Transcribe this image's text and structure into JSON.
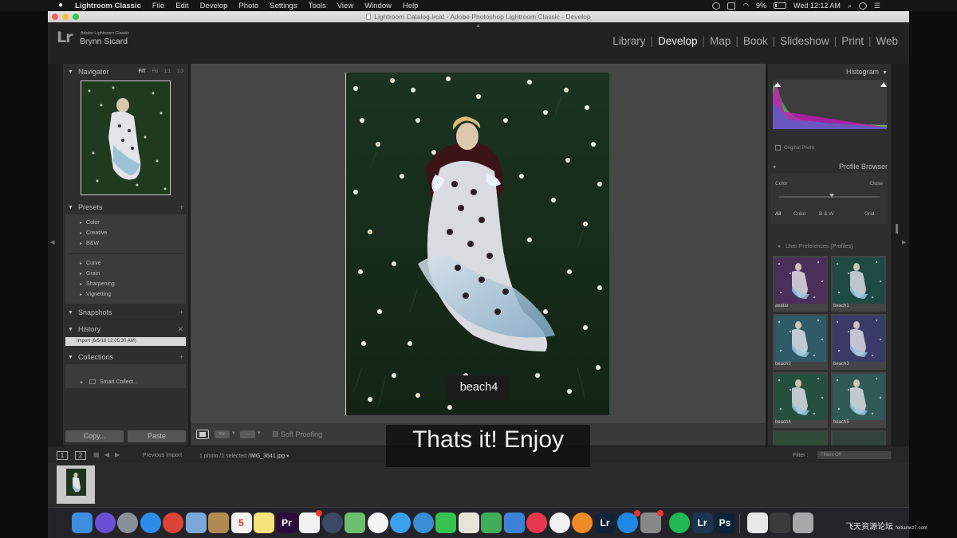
{
  "menubar": {
    "app_name": "Lightroom Classic",
    "items": [
      "File",
      "Edit",
      "Develop",
      "Photo",
      "Settings",
      "Tools",
      "View",
      "Window",
      "Help"
    ],
    "battery": "9%",
    "clock": "Wed 12:12 AM"
  },
  "window": {
    "title": "Lightroom Catalog.lrcat - Adobe Photoshop Lightroom Classic - Develop"
  },
  "identity": {
    "logo": "Lr",
    "app_label": "Adobe Lightroom Classic",
    "user": "Brynn Sicard"
  },
  "modules": [
    {
      "label": "Library",
      "active": false
    },
    {
      "label": "Develop",
      "active": true
    },
    {
      "label": "Map",
      "active": false
    },
    {
      "label": "Book",
      "active": false
    },
    {
      "label": "Slideshow",
      "active": false
    },
    {
      "label": "Print",
      "active": false
    },
    {
      "label": "Web",
      "active": false
    }
  ],
  "left": {
    "navigator": {
      "title": "Navigator",
      "zoom_fit": "FIT",
      "zoom_rest": "Fill  1:1  1:3"
    },
    "presets": {
      "title": "Presets",
      "group1": [
        "Color",
        "Creative",
        "B&W"
      ],
      "group2": [
        "Curve",
        "Grain",
        "Sharpening",
        "Vignetting"
      ]
    },
    "snapshots": {
      "title": "Snapshots"
    },
    "history": {
      "title": "History",
      "item": "Import (6/5/18 12:05:30 AM)"
    },
    "collections": {
      "title": "Collections",
      "item": "Smart Collect..."
    },
    "copy_label": "Copy...",
    "paste_label": "Paste"
  },
  "center": {
    "photo_label": "beach4",
    "soft_proofing": "Soft Proofing"
  },
  "caption": "Thats it! Enjoy",
  "right": {
    "histogram": {
      "title": "Histogram",
      "original_photo": "Original Photo"
    },
    "profile_browser": {
      "title": "Profile Browser",
      "color_label": "Color",
      "close_label": "Close",
      "filters": [
        "All",
        "Color",
        "B & W",
        "Grid"
      ]
    },
    "user_presets": {
      "title": "User Preferences (Profiles)",
      "tiles": [
        {
          "label": "avatar",
          "tint": "#4a2f5a"
        },
        {
          "label": "beach1",
          "tint": "#1f4a44"
        },
        {
          "label": "beach2",
          "tint": "#2f5a68"
        },
        {
          "label": "beach3",
          "tint": "#3a3a68"
        },
        {
          "label": "beach4",
          "tint": "#255040"
        },
        {
          "label": "beach5",
          "tint": "#2f5a55"
        }
      ]
    }
  },
  "filmstrip": {
    "view1": "1",
    "view2": "2",
    "source": "Previous Import",
    "info": "1 photo /1 selected /",
    "filename": "IMG_3641.jpg",
    "filter_label": "Filter :",
    "filter_value": "Filters Off"
  },
  "dock": {
    "apps": [
      {
        "name": "finder-icon",
        "color": "#3d8de0",
        "text": ""
      },
      {
        "name": "siri-icon",
        "color": "#6b4fd6",
        "text": "",
        "round": true
      },
      {
        "name": "launchpad-icon",
        "color": "#8a8f99",
        "text": "",
        "round": true
      },
      {
        "name": "safari-icon",
        "color": "#2e8be8",
        "text": "",
        "round": true
      },
      {
        "name": "chrome-icon",
        "color": "#db4437",
        "text": "",
        "round": true
      },
      {
        "name": "preview-icon",
        "color": "#7aa6d8",
        "text": ""
      },
      {
        "name": "notefile-icon",
        "color": "#b08a50",
        "text": ""
      },
      {
        "name": "calendar-icon",
        "color": "#f2f2f2",
        "text": "5"
      },
      {
        "name": "notes-icon",
        "color": "#f5e27a",
        "text": ""
      },
      {
        "name": "premiere-icon",
        "color": "#2a0b3e",
        "text": "Pr"
      },
      {
        "name": "reminders-icon",
        "color": "#f2f2f2",
        "text": "",
        "badge": true
      },
      {
        "name": "davinci-icon",
        "color": "#3a4a66",
        "text": "",
        "round": true
      },
      {
        "name": "maps-icon",
        "color": "#6cbf6c",
        "text": ""
      },
      {
        "name": "photos-icon",
        "color": "#f3f3f3",
        "text": "",
        "round": true
      },
      {
        "name": "messages-icon",
        "color": "#3aa0f0",
        "text": "",
        "round": true
      },
      {
        "name": "network-icon",
        "color": "#3a8ed8",
        "text": "",
        "round": true
      },
      {
        "name": "facetime-icon",
        "color": "#35c24f",
        "text": ""
      },
      {
        "name": "textedit-icon",
        "color": "#e8e4d8",
        "text": ""
      },
      {
        "name": "numbers-icon",
        "color": "#3fae5a",
        "text": ""
      },
      {
        "name": "keynote-icon",
        "color": "#3b82d8",
        "text": ""
      },
      {
        "name": "news-icon",
        "color": "#e8394e",
        "text": "",
        "round": true
      },
      {
        "name": "itunes-icon",
        "color": "#f0f0f0",
        "text": "",
        "round": true
      },
      {
        "name": "books-icon",
        "color": "#f08a24",
        "text": "",
        "round": true
      },
      {
        "name": "lightroom-icon",
        "color": "#10233a",
        "text": "Lr"
      },
      {
        "name": "appstore-icon",
        "color": "#1e88e5",
        "text": "",
        "round": true,
        "badge": true
      },
      {
        "name": "systemprefs-icon",
        "color": "#888888",
        "text": "",
        "badge": true
      },
      {
        "name": "spotify-icon",
        "color": "#1db954",
        "text": "",
        "round": true
      },
      {
        "name": "lightroom2-icon",
        "color": "#1b3550",
        "text": "Lr"
      },
      {
        "name": "photoshop-icon",
        "color": "#0c2438",
        "text": "Ps"
      },
      {
        "name": "document-icon",
        "color": "#e8e8e8",
        "text": ""
      },
      {
        "name": "finder-window-icon",
        "color": "#3b3b3b",
        "text": ""
      },
      {
        "name": "trash-icon",
        "color": "#a8a8a8",
        "text": ""
      }
    ],
    "watermark": "飞天资源论坛",
    "watermark_url": "feitianwz7.com"
  }
}
